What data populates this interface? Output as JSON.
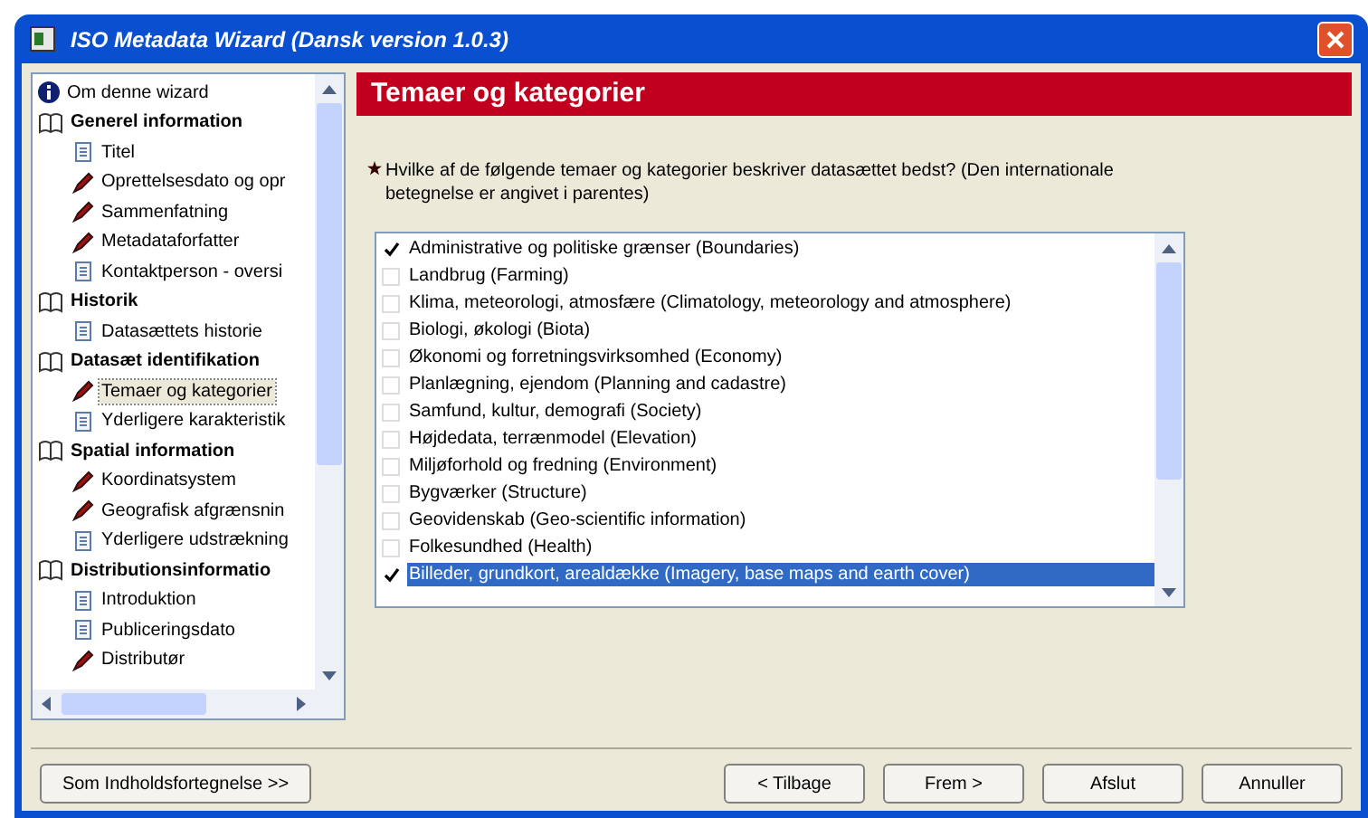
{
  "window": {
    "title": "ISO Metadata Wizard  (Dansk version 1.0.3)"
  },
  "tree": [
    {
      "label": "Om denne wizard",
      "kind": "info",
      "selected": false
    },
    {
      "label": "Generel information",
      "kind": "book",
      "selected": false,
      "children": [
        {
          "label": "Titel",
          "kind": "page",
          "selected": false
        },
        {
          "label": "Oprettelsesdato og opr",
          "kind": "required",
          "selected": false
        },
        {
          "label": "Sammenfatning",
          "kind": "required",
          "selected": false
        },
        {
          "label": "Metadataforfatter",
          "kind": "required",
          "selected": false
        },
        {
          "label": "Kontaktperson - oversi",
          "kind": "page",
          "selected": false
        }
      ]
    },
    {
      "label": "Historik",
      "kind": "book",
      "selected": false,
      "children": [
        {
          "label": "Datasættets historie",
          "kind": "page",
          "selected": false
        }
      ]
    },
    {
      "label": "Datasæt identifikation",
      "kind": "book",
      "selected": false,
      "children": [
        {
          "label": "Temaer og kategorier",
          "kind": "required",
          "selected": true
        },
        {
          "label": "Yderligere karakteristik",
          "kind": "page",
          "selected": false
        }
      ]
    },
    {
      "label": "Spatial information",
      "kind": "book",
      "selected": false,
      "children": [
        {
          "label": "Koordinatsystem",
          "kind": "required",
          "selected": false
        },
        {
          "label": "Geografisk afgrænsnin",
          "kind": "required",
          "selected": false
        },
        {
          "label": "Yderligere udstrækning",
          "kind": "page",
          "selected": false
        }
      ]
    },
    {
      "label": "Distributionsinformatio",
      "kind": "book",
      "selected": false,
      "children": [
        {
          "label": "Introduktion",
          "kind": "page",
          "selected": false
        },
        {
          "label": "Publiceringsdato",
          "kind": "page",
          "selected": false
        },
        {
          "label": "Distributør",
          "kind": "required",
          "selected": false
        }
      ]
    }
  ],
  "header": "Temaer og kategorier",
  "question": "Hvilke af de følgende temaer og kategorier beskriver datasættet bedst?  (Den internationale betegnelse er angivet i parentes)",
  "options": [
    {
      "label": "Administrative og politiske grænser  (Boundaries)",
      "checked": true,
      "selected": false
    },
    {
      "label": "Landbrug  (Farming)",
      "checked": false,
      "selected": false
    },
    {
      "label": "Klima, meteorologi, atmosfære  (Climatology, meteorology and atmosphere)",
      "checked": false,
      "selected": false
    },
    {
      "label": "Biologi, økologi  (Biota)",
      "checked": false,
      "selected": false
    },
    {
      "label": "Økonomi og forretningsvirksomhed  (Economy)",
      "checked": false,
      "selected": false
    },
    {
      "label": "Planlægning, ejendom  (Planning and cadastre)",
      "checked": false,
      "selected": false
    },
    {
      "label": "Samfund, kultur, demografi  (Society)",
      "checked": false,
      "selected": false
    },
    {
      "label": "Højdedata, terrænmodel  (Elevation)",
      "checked": false,
      "selected": false
    },
    {
      "label": "Miljøforhold og fredning  (Environment)",
      "checked": false,
      "selected": false
    },
    {
      "label": "Bygværker  (Structure)",
      "checked": false,
      "selected": false
    },
    {
      "label": "Geovidenskab  (Geo-scientific information)",
      "checked": false,
      "selected": false
    },
    {
      "label": "Folkesundhed  (Health)",
      "checked": false,
      "selected": false
    },
    {
      "label": "Billeder, grundkort, arealdække  (Imagery, base maps and earth cover)",
      "checked": true,
      "selected": true
    }
  ],
  "buttons": [
    {
      "label": "Som Indholdsfortegnelse >>"
    },
    {
      "label": "< Tilbage"
    },
    {
      "label": "Frem >"
    },
    {
      "label": "Afslut"
    },
    {
      "label": "Annuller"
    }
  ]
}
